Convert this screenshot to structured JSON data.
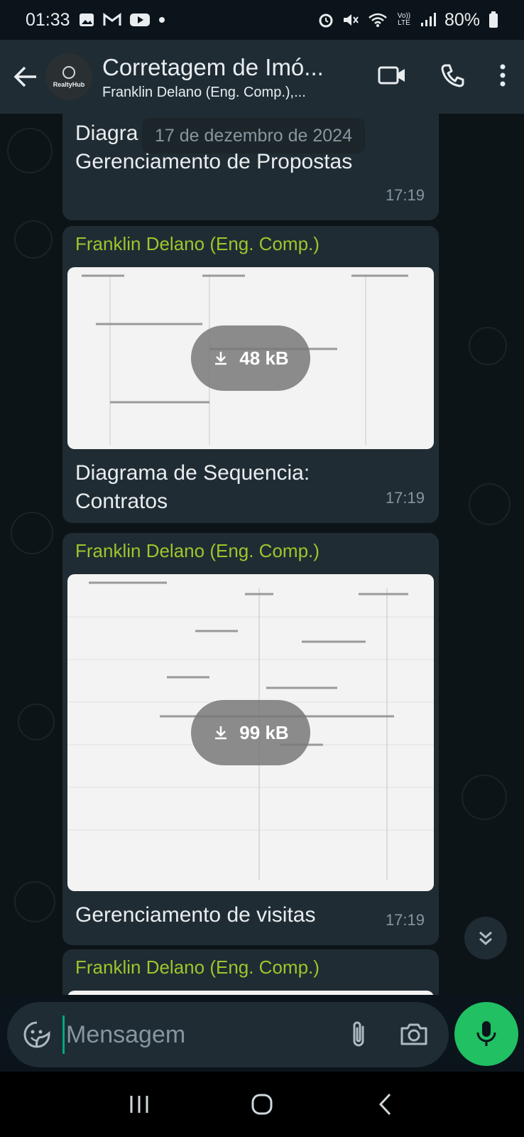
{
  "status_bar": {
    "time": "01:33",
    "left_icons": [
      "image-icon",
      "gmail-icon",
      "youtube-icon",
      "dot-icon"
    ],
    "right_icons": [
      "alarm-icon",
      "mute-icon",
      "wifi-icon",
      "volte-icon",
      "signal-icon"
    ],
    "volte_label": "Vo)) LTE",
    "battery": "80%"
  },
  "header": {
    "title": "Corretagem de Imó...",
    "subtitle": "Franklin Delano (Eng. Comp.),...",
    "avatar_text": "RealtyHub"
  },
  "chat": {
    "date_chip": "17 de dezembro de 2024",
    "messages": [
      {
        "sender": "",
        "caption_line1": "Diagra",
        "caption_line2": "Gerenciamento de Propostas",
        "time": "17:19"
      },
      {
        "sender": "Franklin Delano (Eng. Comp.)",
        "size": "48 kB",
        "caption_line1": "Diagrama de Sequencia:",
        "caption_line2": "Contratos",
        "time": "17:19"
      },
      {
        "sender": "Franklin Delano (Eng. Comp.)",
        "size": "99 kB",
        "caption_line1": "Gerenciamento de visitas",
        "time": "17:19"
      },
      {
        "sender": "Franklin Delano (Eng. Comp.)"
      }
    ]
  },
  "composer": {
    "placeholder": "Mensagem"
  },
  "colors": {
    "background": "#0b141a",
    "header": "#1f2c34",
    "bubble": "#202c33",
    "sender_name": "#9fc52c",
    "accent_green": "#21c063",
    "timestamp": "#8696a0"
  }
}
